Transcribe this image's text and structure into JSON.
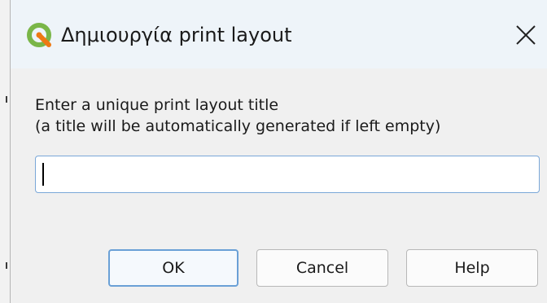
{
  "window": {
    "title": "Δημιουργία print layout",
    "app_icon": "qgis-logo-icon",
    "close_icon": "close-icon"
  },
  "form": {
    "label_line1": "Enter a unique print layout title",
    "label_line2": "(a title will be automatically generated if left empty)",
    "input_value": "",
    "input_placeholder": ""
  },
  "buttons": {
    "ok_label": "OK",
    "cancel_label": "Cancel",
    "help_label": "Help"
  },
  "colors": {
    "titlebar": "#eef4f9",
    "dialog_background": "#f0f0f0",
    "focus_accent": "#6aa0d6",
    "qgis_green": "#7ab648",
    "qgis_orange": "#ee7913"
  }
}
